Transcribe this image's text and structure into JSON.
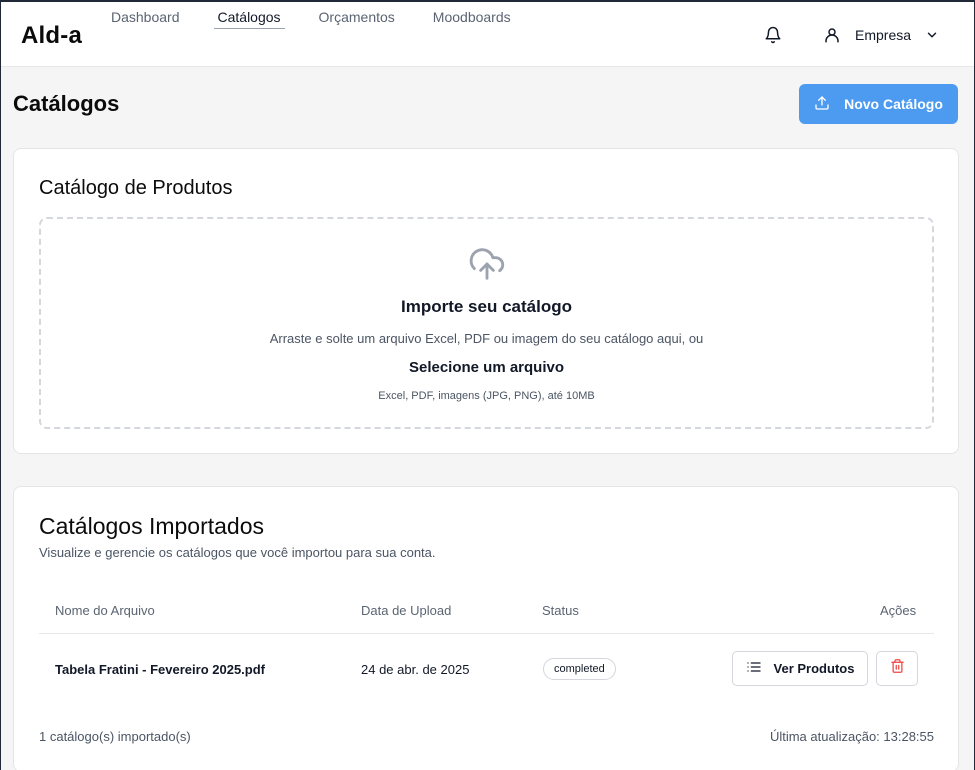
{
  "app": {
    "logo": "Ald-a"
  },
  "nav": {
    "items": [
      {
        "label": "Dashboard"
      },
      {
        "label": "Catálogos"
      },
      {
        "label": "Orçamentos"
      },
      {
        "label": "Moodboards"
      }
    ],
    "active_index": 1
  },
  "header": {
    "bell_icon": "bell-icon",
    "user_icon": "user-icon",
    "user_label": "Empresa",
    "chevron_icon": "chevron-down-icon"
  },
  "page": {
    "title": "Catálogos",
    "new_button": "Novo Catálogo",
    "new_button_icon": "upload-icon"
  },
  "upload_card": {
    "title": "Catálogo de Produtos",
    "icon": "cloud-upload-icon",
    "heading": "Importe seu catálogo",
    "description": "Arraste e solte um arquivo Excel, PDF ou imagem do seu catálogo aqui, ou",
    "select_label": "Selecione um arquivo",
    "hint": "Excel, PDF, imagens (JPG, PNG), até 10MB"
  },
  "imported": {
    "title": "Catálogos Importados",
    "subtitle": "Visualize e gerencie os catálogos que você importou para sua conta.",
    "columns": [
      "Nome do Arquivo",
      "Data de Upload",
      "Status",
      "Ações"
    ],
    "rows": [
      {
        "file_name": "Tabela Fratini - Fevereiro 2025.pdf",
        "upload_date": "24 de abr. de 2025",
        "status": "completed",
        "view_label": "Ver Produtos",
        "view_icon": "list-icon",
        "delete_icon": "trash-icon"
      }
    ],
    "count_text": "1 catálogo(s) importado(s)",
    "updated_text": "Última atualização: 13:28:55"
  },
  "colors": {
    "primary": "#4c9bf0",
    "danger": "#ef4444",
    "border": "#e3e5e8"
  }
}
